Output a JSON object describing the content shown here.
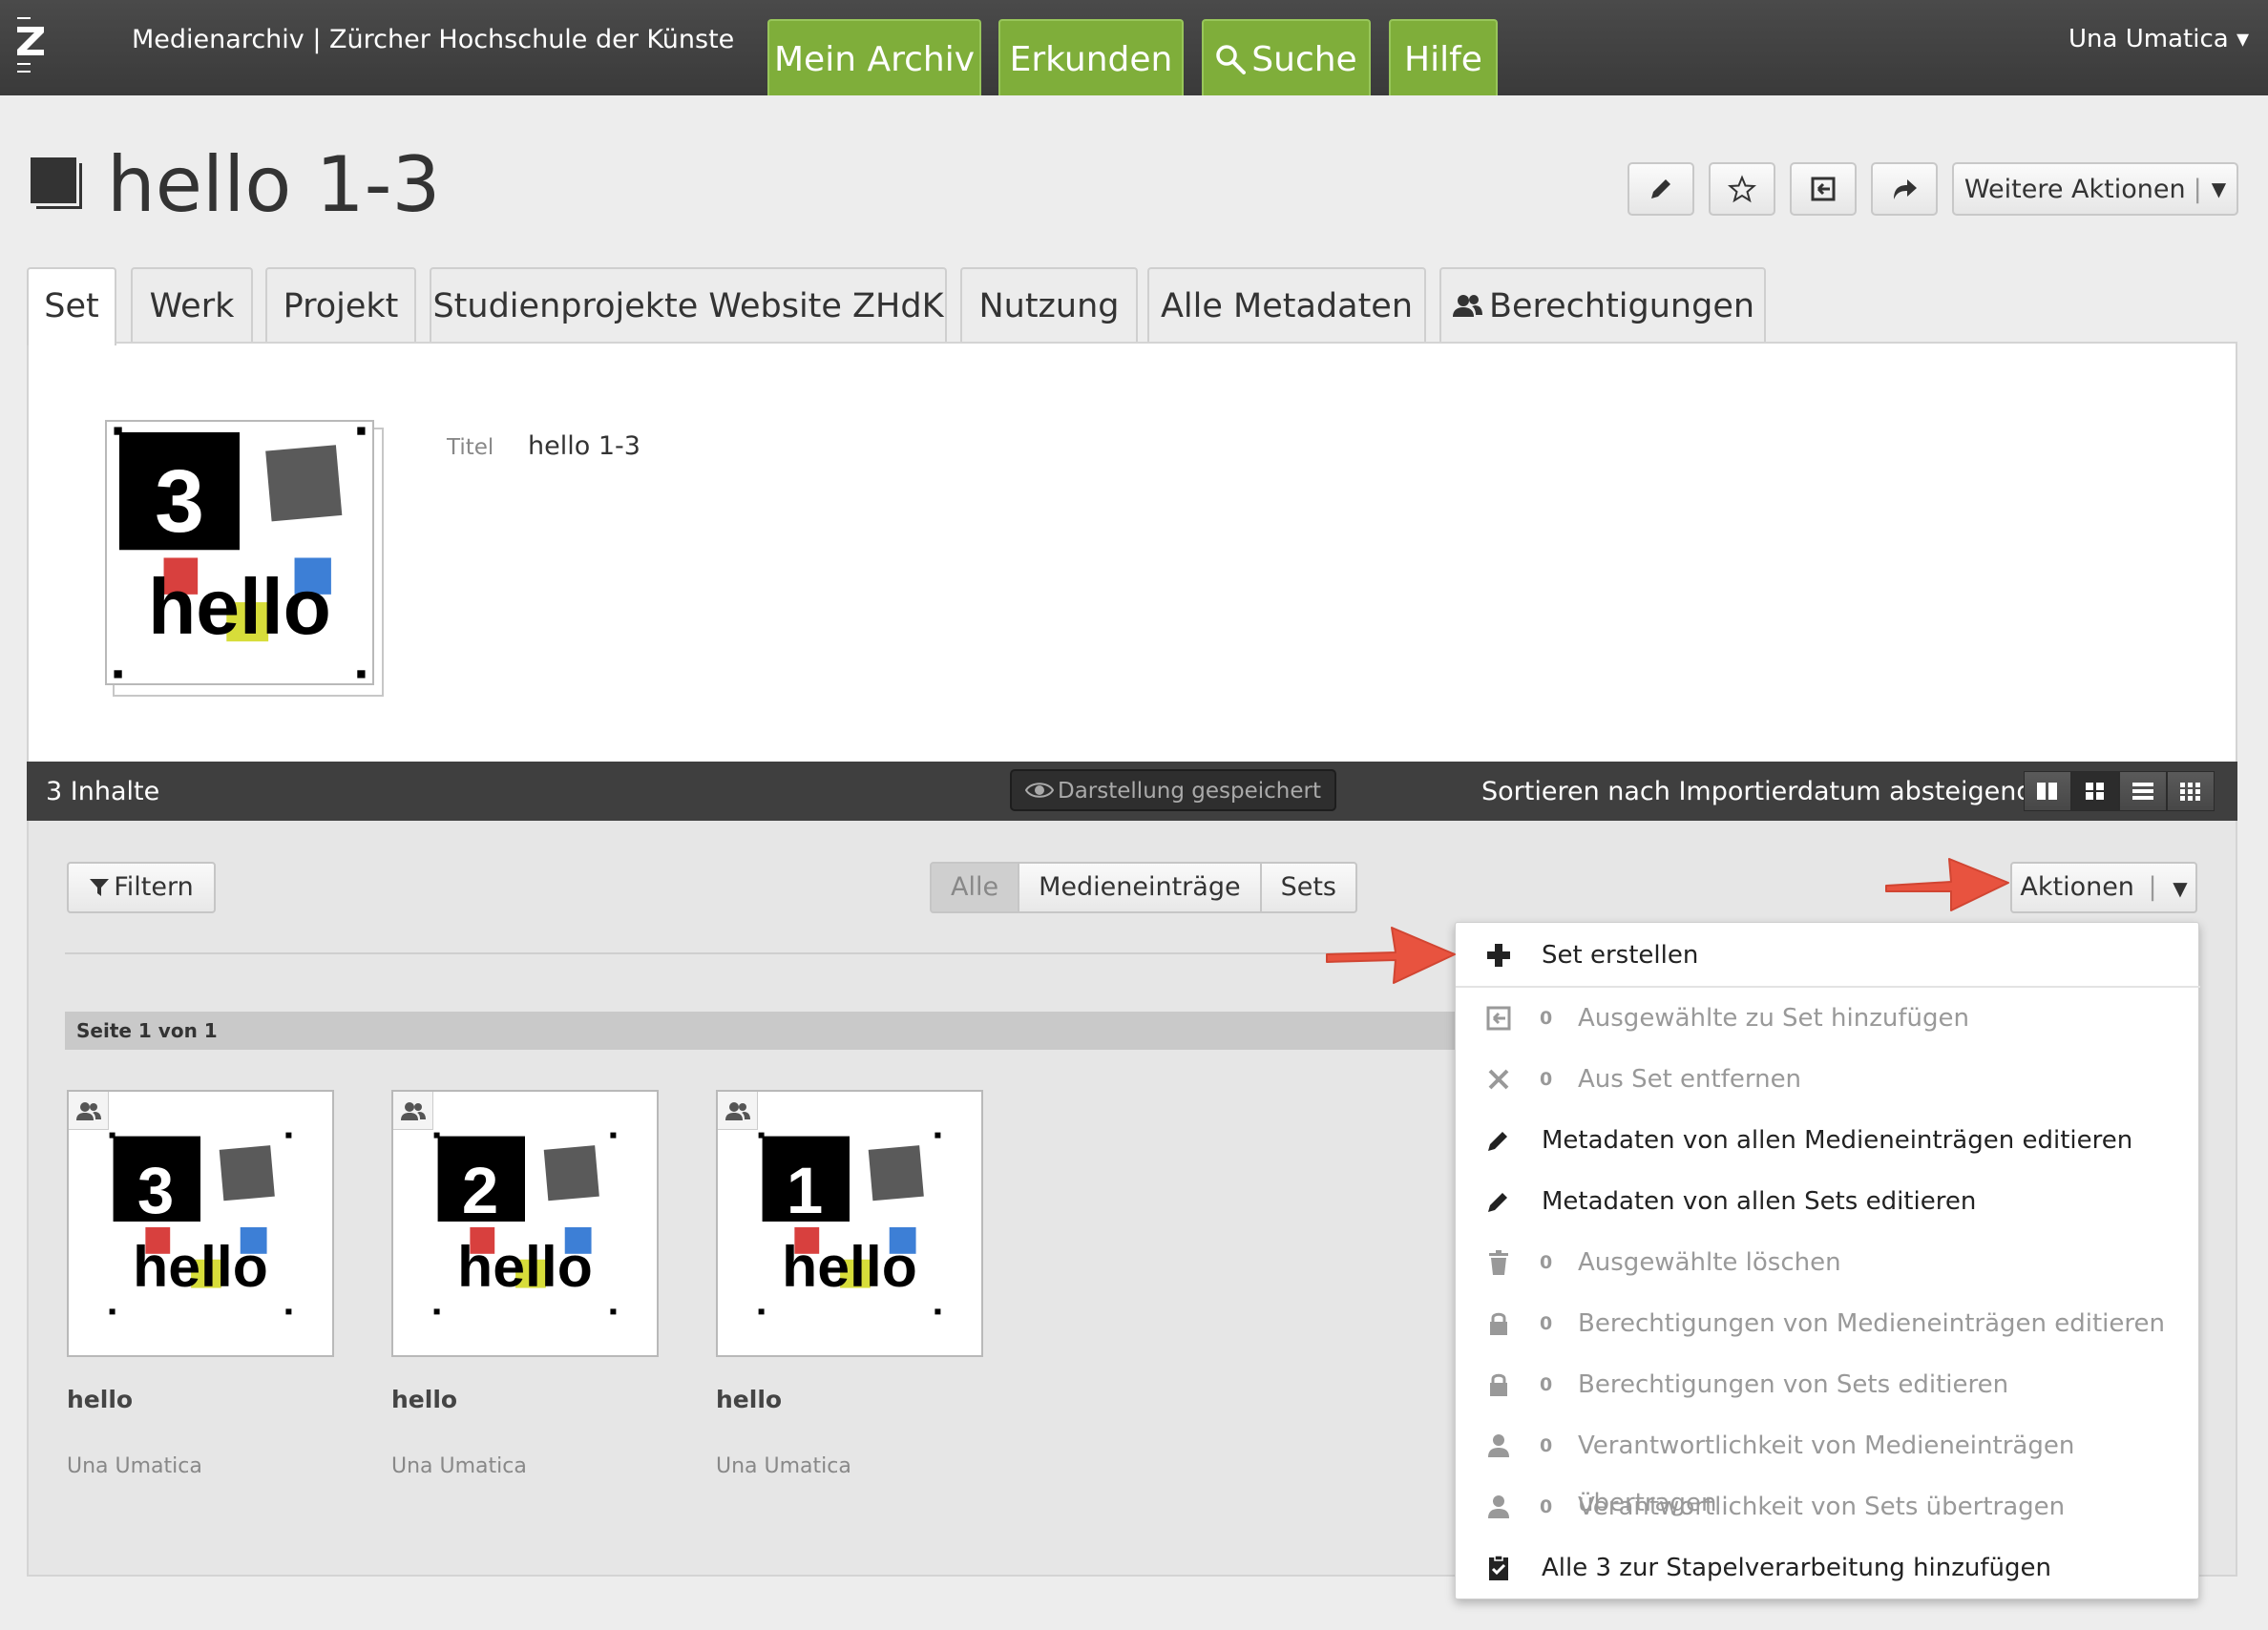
{
  "topbar": {
    "brand": "Medienarchiv | Zürcher Hochschule der Künste",
    "nav": [
      "Mein Archiv",
      "Erkunden",
      "Suche",
      "Hilfe"
    ],
    "user": "Una Umatica ▾",
    "accent_color": "#7fae3a"
  },
  "title": "hello 1-3",
  "toolbar": {
    "icons": [
      "pencil-icon",
      "star-icon",
      "add-to-set-icon",
      "share-icon"
    ],
    "more_actions": "Weitere Aktionen"
  },
  "tabs": [
    "Set",
    "Werk",
    "Projekt",
    "Studienprojekte Website ZHdK",
    "Nutzung",
    "Alle Metadaten",
    "Berechtigungen"
  ],
  "meta": {
    "label": "Titel",
    "value": "hello 1-3"
  },
  "cover": {
    "number": "3",
    "word": "hello"
  },
  "bar": {
    "count": "3 Inhalte",
    "saved": "Darstellung gespeichert",
    "sort": "Sortieren nach Importierdatum absteigend ▾"
  },
  "filter_label": "Filtern",
  "segments": [
    "Alle",
    "Medieneinträge",
    "Sets"
  ],
  "actions_label": "Aktionen",
  "page_label": "Seite 1 von 1",
  "cards": [
    {
      "number": "3",
      "word": "hello",
      "title": "hello",
      "owner": "Una Umatica"
    },
    {
      "number": "2",
      "word": "hello",
      "title": "hello",
      "owner": "Una Umatica"
    },
    {
      "number": "1",
      "word": "hello",
      "title": "hello",
      "owner": "Una Umatica"
    }
  ],
  "menu": [
    {
      "icon": "plus-icon",
      "count": "",
      "label": "Set erstellen",
      "enabled": true
    },
    {
      "icon": "add-to-set-icon",
      "count": "0",
      "label": "Ausgewählte zu Set hinzufügen",
      "enabled": false
    },
    {
      "icon": "close-icon",
      "count": "0",
      "label": "Aus Set entfernen",
      "enabled": false
    },
    {
      "icon": "pencil-icon",
      "count": "",
      "label": "Metadaten von allen Medieneinträgen editieren",
      "enabled": true
    },
    {
      "icon": "pencil-icon",
      "count": "",
      "label": "Metadaten von allen Sets editieren",
      "enabled": true
    },
    {
      "icon": "trash-icon",
      "count": "0",
      "label": "Ausgewählte löschen",
      "enabled": false
    },
    {
      "icon": "lock-icon",
      "count": "0",
      "label": "Berechtigungen von Medieneinträgen editieren",
      "enabled": false
    },
    {
      "icon": "lock-icon",
      "count": "0",
      "label": "Berechtigungen von Sets editieren",
      "enabled": false
    },
    {
      "icon": "user-icon",
      "count": "0",
      "label": "Verantwortlichkeit von Medieneinträgen übertragen",
      "enabled": false
    },
    {
      "icon": "user-icon",
      "count": "0",
      "label": "Verantwortlichkeit von Sets übertragen",
      "enabled": false
    },
    {
      "icon": "clipboard-check-icon",
      "count": "",
      "label": "Alle 3 zur Stapelverarbeitung hinzufügen",
      "enabled": true
    }
  ],
  "annotation_color": "#e8533f"
}
